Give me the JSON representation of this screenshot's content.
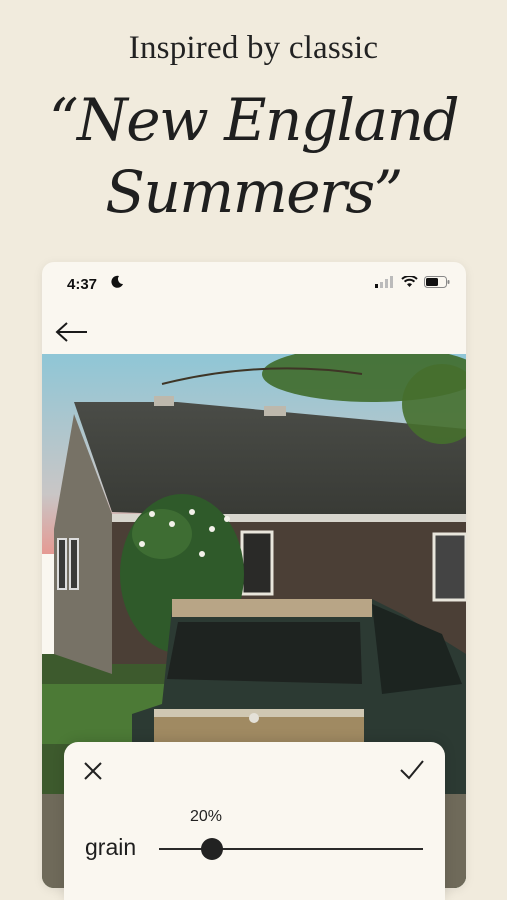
{
  "promo": {
    "subtitle": "Inspired by classic",
    "headline_line1": "“New England",
    "headline_line2": "Summers”"
  },
  "status_bar": {
    "time": "4:37",
    "icons": [
      "moon-icon",
      "cellular-signal-icon",
      "wifi-icon",
      "battery-icon"
    ]
  },
  "nav": {
    "back_icon": "arrow-left-icon"
  },
  "photo": {
    "description_icon": "photo"
  },
  "editor": {
    "close_icon": "close-icon",
    "confirm_icon": "checkmark-icon",
    "adjustment_label": "grain",
    "value_label": "20%",
    "value": 0.2
  },
  "colors": {
    "background": "#f1ebdd",
    "card": "#faf7f0",
    "text": "#1f1f1f"
  }
}
